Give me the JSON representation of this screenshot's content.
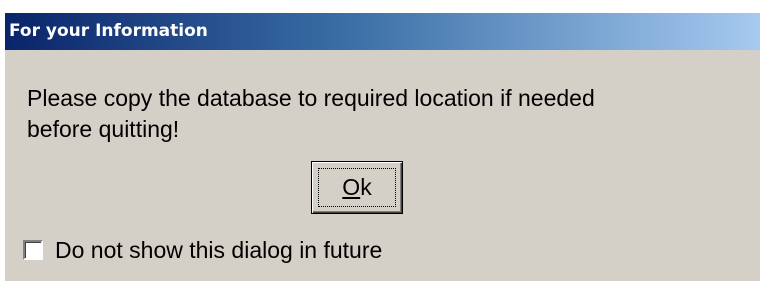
{
  "dialog": {
    "title": "For your Information",
    "message_line1": "Please copy the database to required location if needed",
    "message_line2": " before quitting!",
    "ok_button": {
      "mnemonic": "O",
      "rest": "k"
    },
    "checkbox": {
      "label": "Do not show this dialog in future",
      "checked": false
    }
  },
  "colors": {
    "face": "#d4d0c8",
    "title_start": "#0a246a",
    "title_end": "#a6caf0",
    "title_text": "#ffffff"
  }
}
